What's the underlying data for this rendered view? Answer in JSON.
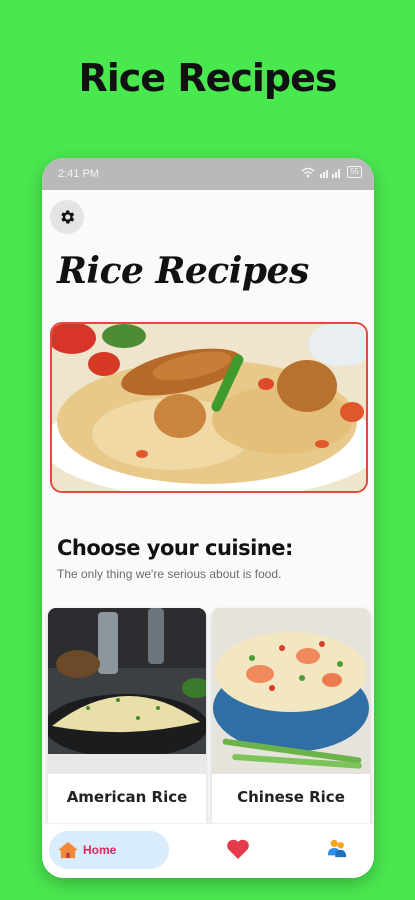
{
  "promo": {
    "title": "Rice Recipes",
    "background_color": "#4ae84f"
  },
  "status_bar": {
    "time": "2:41 PM",
    "battery": "55",
    "icons": [
      "wifi-icon",
      "signal-icon",
      "battery-icon"
    ]
  },
  "header": {
    "settings_icon": "gear-icon",
    "title": "Rice Recipes"
  },
  "hero": {
    "image": "chicken-biryani-photo",
    "border_color": "#e24a3c"
  },
  "section": {
    "title": "Choose your cuisine:",
    "subtitle": "The only thing we're serious about is food."
  },
  "cuisines": [
    {
      "label": "American Rice",
      "image": "american-fried-rice-photo"
    },
    {
      "label": "Chinese Rice",
      "image": "chinese-fried-rice-photo"
    }
  ],
  "bottom_nav": {
    "home_label": "Home",
    "home_icon": "home-icon",
    "favorites_icon": "heart-icon",
    "profile_icon": "profile-icon",
    "accent_color": "#e0245e"
  }
}
